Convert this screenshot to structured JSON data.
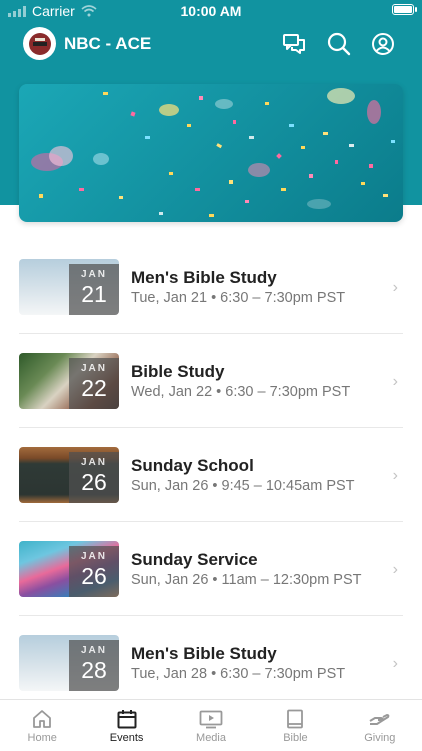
{
  "status_bar": {
    "carrier": "Carrier",
    "time": "10:00 AM"
  },
  "header": {
    "title": "NBC - ACE"
  },
  "events": [
    {
      "month": "JAN",
      "day": "21",
      "title": "Men's Bible Study",
      "subtitle": "Tue, Jan 21 • 6:30 – 7:30pm PST"
    },
    {
      "month": "JAN",
      "day": "22",
      "title": "Bible Study",
      "subtitle": "Wed, Jan 22 • 6:30 – 7:30pm PST"
    },
    {
      "month": "JAN",
      "day": "26",
      "title": "Sunday School",
      "subtitle": "Sun, Jan 26 • 9:45 – 10:45am PST"
    },
    {
      "month": "JAN",
      "day": "26",
      "title": "Sunday Service",
      "subtitle": "Sun, Jan 26 • 11am – 12:30pm PST"
    },
    {
      "month": "JAN",
      "day": "28",
      "title": "Men's Bible Study",
      "subtitle": "Tue, Jan 28 • 6:30 – 7:30pm PST"
    }
  ],
  "tabs": [
    {
      "label": "Home",
      "icon": "home-icon"
    },
    {
      "label": "Events",
      "icon": "calendar-icon"
    },
    {
      "label": "Media",
      "icon": "media-icon"
    },
    {
      "label": "Bible",
      "icon": "book-icon"
    },
    {
      "label": "Giving",
      "icon": "giving-icon"
    }
  ],
  "active_tab": "Events",
  "colors": {
    "brand": "#1193a0",
    "active_tab": "#222222",
    "inactive_tab": "#999999"
  }
}
